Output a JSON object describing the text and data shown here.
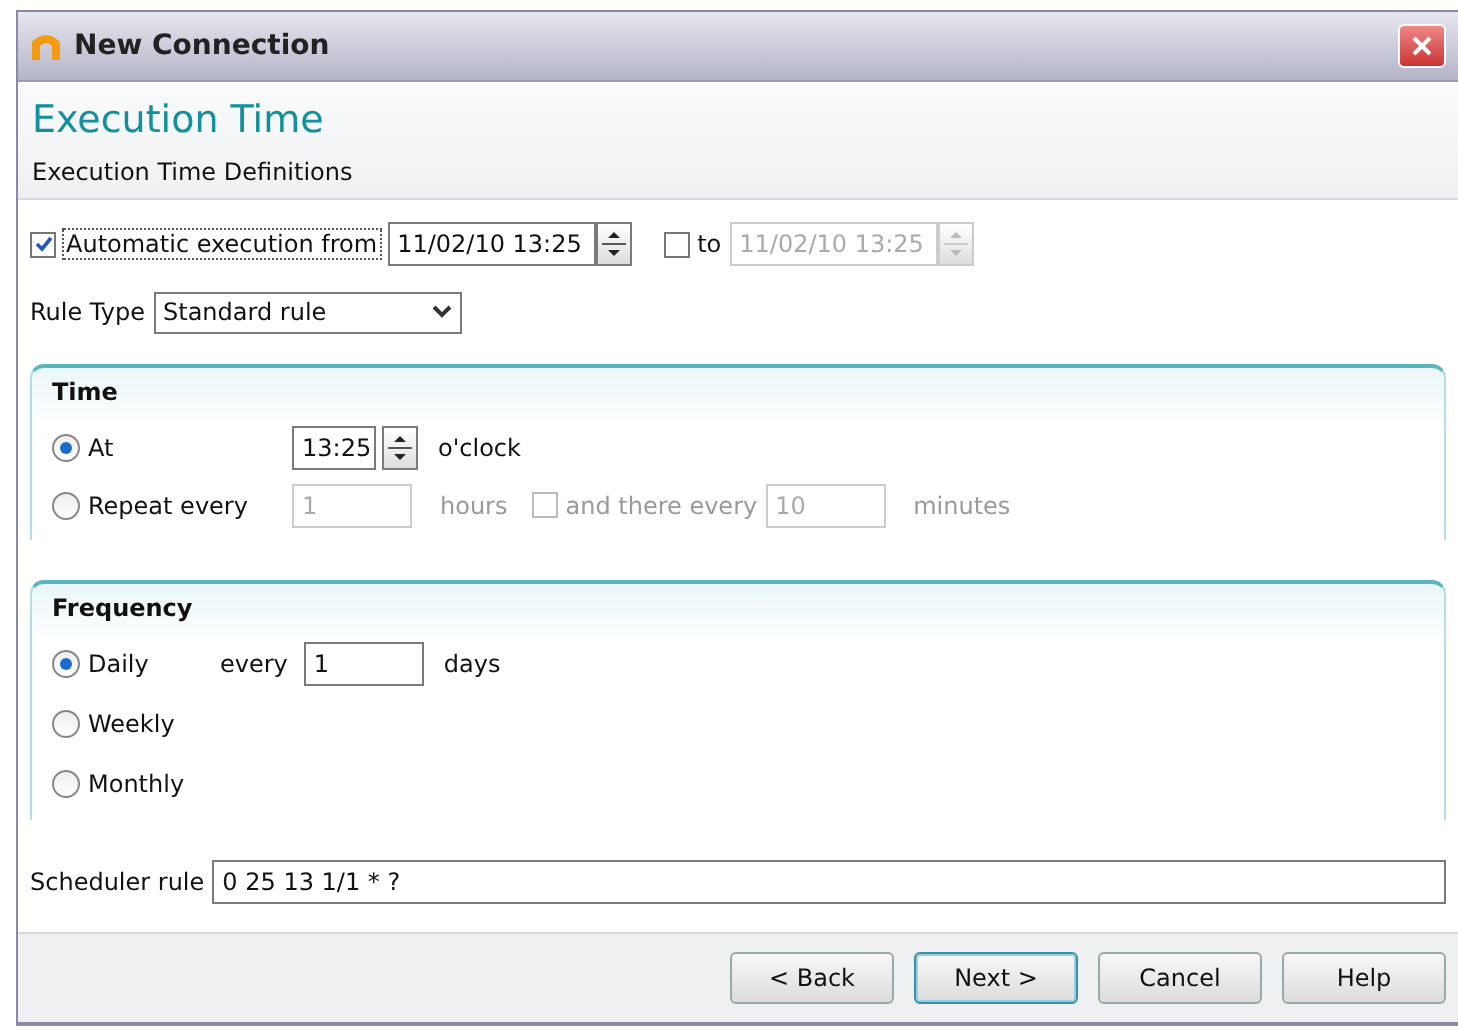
{
  "window": {
    "title": "New Connection"
  },
  "header": {
    "title": "Execution Time",
    "subtitle": "Execution Time Definitions"
  },
  "automatic": {
    "label": "Automatic execution from",
    "checked": true,
    "value": "11/02/10 13:25",
    "to": {
      "label": "to",
      "checked": false,
      "value": "11/02/10 13:25"
    }
  },
  "rule_type": {
    "label": "Rule Type",
    "value": "Standard rule"
  },
  "time": {
    "title": "Time",
    "options": [
      {
        "kind": "at",
        "label": "At",
        "selected": true,
        "value": "13:25",
        "unit": "o'clock"
      },
      {
        "kind": "repeat",
        "label": "Repeat every",
        "selected": false,
        "value": "1",
        "unit": "hours",
        "extra": {
          "label": "and there every",
          "checked": false,
          "value": "10",
          "unit": "minutes"
        }
      }
    ]
  },
  "frequency": {
    "title": "Frequency",
    "options": [
      {
        "label": "Daily",
        "selected": true,
        "every_label": "every",
        "value": "1",
        "unit": "days"
      },
      {
        "label": "Weekly",
        "selected": false
      },
      {
        "label": "Monthly",
        "selected": false
      }
    ]
  },
  "scheduler_rule": {
    "label": "Scheduler rule",
    "value": "0 25 13 1/1 * ?"
  },
  "buttons": [
    {
      "label": "< Back",
      "default": false
    },
    {
      "label": "Next >",
      "default": true
    },
    {
      "label": "Cancel",
      "default": false
    },
    {
      "label": "Help",
      "default": false
    }
  ]
}
